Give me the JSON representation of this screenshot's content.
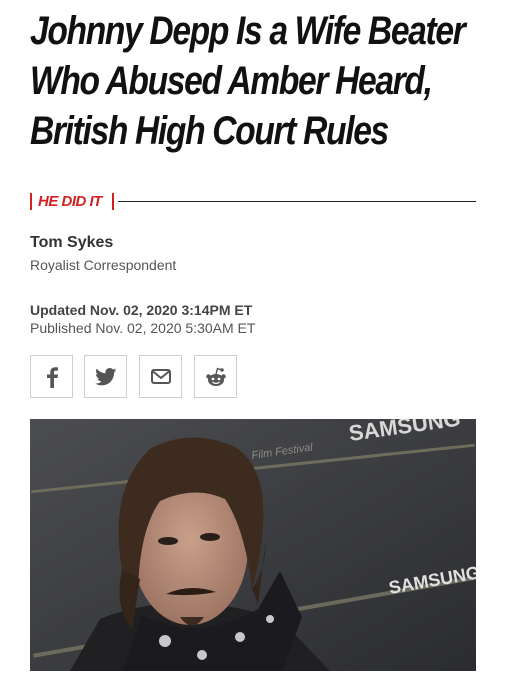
{
  "article": {
    "headline_lines": [
      "Johnny Depp Is a Wife Beater",
      "Who Abused Amber Heard,",
      "British High Court Rules"
    ],
    "tag": "HE DID IT",
    "author": {
      "name": "Tom Sykes",
      "role": "Royalist Correspondent"
    },
    "updated": "Updated Nov. 02, 2020 3:14PM ET",
    "published": "Published Nov. 02, 2020 5:30AM ET"
  },
  "share": {
    "buttons": [
      {
        "icon": "facebook-icon"
      },
      {
        "icon": "twitter-icon"
      },
      {
        "icon": "email-icon"
      },
      {
        "icon": "reddit-icon"
      }
    ]
  },
  "photo": {
    "backdrop_text": [
      "SAMSUNG",
      "SAMSUNG",
      "Film Festival"
    ]
  },
  "colors": {
    "accent": "#d21f1f",
    "headline": "#111111",
    "icon": "#555555",
    "border": "#cfcfcf"
  }
}
